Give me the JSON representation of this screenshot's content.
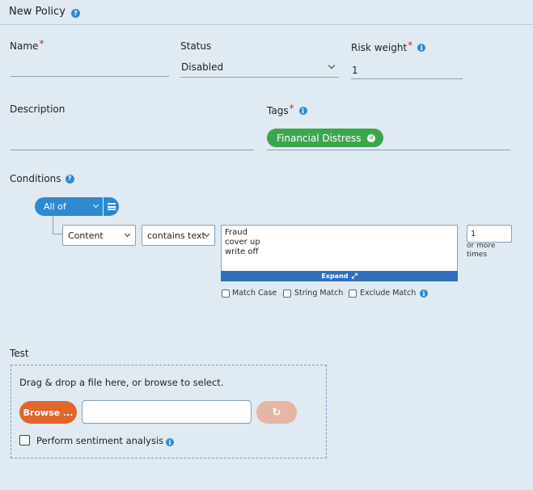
{
  "header": {
    "title": "New Policy"
  },
  "name": {
    "label": "Name",
    "value": ""
  },
  "status": {
    "label": "Status",
    "value": "Disabled"
  },
  "risk_weight": {
    "label": "Risk weight",
    "value": "1"
  },
  "description": {
    "label": "Description",
    "value": ""
  },
  "tags": {
    "label": "Tags",
    "items": [
      "Financial Distress"
    ]
  },
  "conditions": {
    "label": "Conditions",
    "group_operator": "All of",
    "rule": {
      "field": "Content",
      "operator": "contains text",
      "terms_line1": "Fraud",
      "terms_line2": "cover up",
      "terms_line3": "write off",
      "expand_label": "Expand",
      "count": "1",
      "count_suffix_line1": "or more",
      "count_suffix_line2": "times",
      "options": [
        "Match Case",
        "String Match",
        "Exclude Match"
      ]
    }
  },
  "test": {
    "label": "Test",
    "dropzone_text": "Drag & drop a file here, or browse to select.",
    "browse_label": "Browse ...",
    "file_value": "",
    "sentiment_label": "Perform sentiment analysis"
  },
  "colors": {
    "background": "#dfeaf2",
    "accent_blue": "#2e8ad0",
    "tag_green": "#3aa84a",
    "browse_orange": "#e0662b",
    "required_red": "#d22222"
  }
}
